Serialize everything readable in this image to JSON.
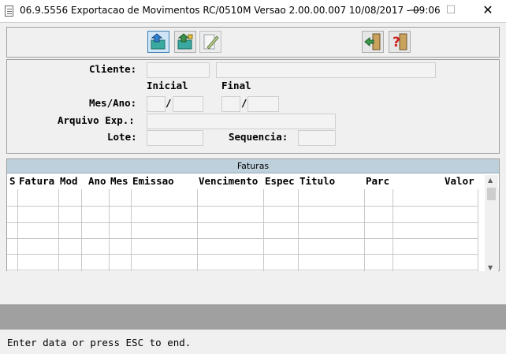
{
  "window": {
    "title": "06.9.5556  Exportacao  de Movimentos RC/0510M Versao 2.00.00.007 10/08/2017 - 09:06",
    "min_glyph": "—",
    "max_glyph": "☐",
    "close_glyph": "✕"
  },
  "toolbar": {
    "buttons": [
      {
        "name": "export-button",
        "icon": "export-icon"
      },
      {
        "name": "export-all-button",
        "icon": "export-all-icon"
      },
      {
        "name": "edit-button",
        "icon": "edit-icon"
      },
      {
        "name": "exit-button",
        "icon": "exit-door-icon"
      },
      {
        "name": "help-button",
        "icon": "help-icon"
      }
    ]
  },
  "form": {
    "cliente_label": "Cliente:",
    "inicial_label": "Inicial",
    "final_label": "Final",
    "mes_ano_label": "Mes/Ano:",
    "slash": "/",
    "arquivo_label": "Arquivo Exp.:",
    "lote_label": "Lote:",
    "sequencia_label": "Sequencia:"
  },
  "grid": {
    "title": "Faturas",
    "columns": [
      "S",
      "Fatura",
      "Mod",
      "Ano",
      "Mes",
      "Emissao",
      "Vencimento",
      "Espec",
      "Titulo",
      "Parc",
      "Valor"
    ]
  },
  "status": {
    "message": "Enter data or press ESC to end."
  },
  "colors": {
    "panel": "#f0f0f0",
    "grid_title": "#bfd0dd",
    "footer": "#a0a0a0"
  }
}
